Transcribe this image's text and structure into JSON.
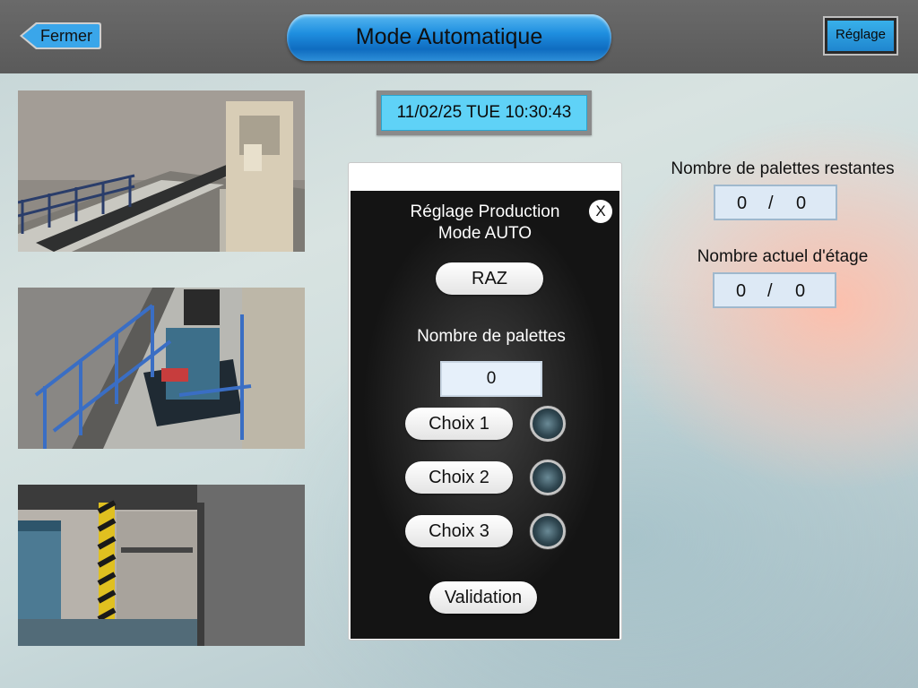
{
  "header": {
    "back_label": "Fermer",
    "title": "Mode Automatique",
    "settings_label": "Réglage"
  },
  "datetime": "11/02/25 TUE 10:30:43",
  "cameras": [
    {
      "name": "camera-view-1"
    },
    {
      "name": "camera-view-2"
    },
    {
      "name": "camera-view-3"
    }
  ],
  "dialog": {
    "title_line1": "Réglage Production",
    "title_line2": "Mode AUTO",
    "close_label": "X",
    "reset_label": "RAZ",
    "pallets_label": "Nombre de palettes",
    "pallets_value": "0",
    "choices": [
      {
        "label": "Choix 1",
        "active": false
      },
      {
        "label": "Choix 2",
        "active": false
      },
      {
        "label": "Choix 3",
        "active": false
      }
    ],
    "validate_label": "Validation"
  },
  "counters": {
    "remaining": {
      "label": "Nombre de palettes restantes",
      "current": "0",
      "separator": "/",
      "total": "0"
    },
    "level": {
      "label": "Nombre actuel d'étage",
      "current": "0",
      "separator": "/",
      "total": "0"
    }
  },
  "colors": {
    "accent_blue": "#1f8fe0",
    "date_bg": "#5fd2f7",
    "header_bg": "#5f5f5f"
  }
}
